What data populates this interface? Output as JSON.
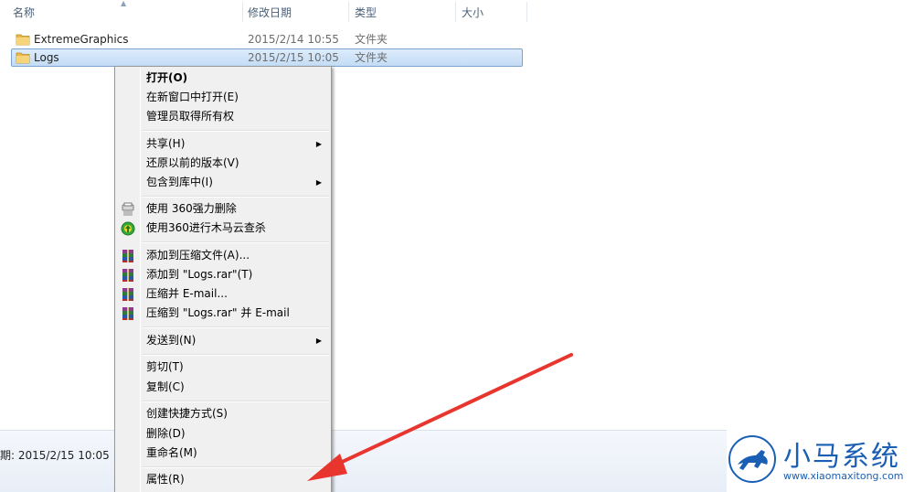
{
  "columns": {
    "name": "名称",
    "date": "修改日期",
    "type": "类型",
    "size": "大小"
  },
  "files": [
    {
      "name": "ExtremeGraphics",
      "date": "2015/2/14 10:55",
      "type": "文件夹",
      "selected": false
    },
    {
      "name": "Logs",
      "date": "2015/2/15 10:05",
      "type": "文件夹",
      "selected": true
    }
  ],
  "context_menu": {
    "items": {
      "open": "打开(O)",
      "open_new_window": "在新窗口中打开(E)",
      "take_ownership": "管理员取得所有权",
      "share": "共享(H)",
      "restore_versions": "还原以前的版本(V)",
      "include_library": "包含到库中(I)",
      "force_delete_360": "使用 360强力删除",
      "trojan_scan_360": "使用360进行木马云查杀",
      "add_archive": "添加到压缩文件(A)...",
      "add_logs_rar": "添加到 \"Logs.rar\"(T)",
      "compress_email": "压缩并 E-mail...",
      "compress_logs_email": "压缩到 \"Logs.rar\" 并 E-mail",
      "send_to": "发送到(N)",
      "cut": "剪切(T)",
      "copy": "复制(C)",
      "create_shortcut": "创建快捷方式(S)",
      "delete": "删除(D)",
      "rename": "重命名(M)",
      "properties": "属性(R)"
    }
  },
  "status_bar": {
    "text": "期: 2015/2/15 10:05"
  },
  "watermark": {
    "title": "小马系统",
    "url": "www.xiaomaxitong.com"
  },
  "colors": {
    "selection": "#cce4fb",
    "arrow": "#e8352e",
    "brand": "#1a5fb4"
  }
}
